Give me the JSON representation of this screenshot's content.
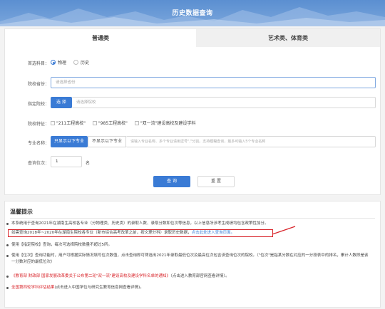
{
  "header": {
    "title": "历史数据查询"
  },
  "tabs": [
    {
      "label": "普通类"
    },
    {
      "label": "艺术类、体育类"
    }
  ],
  "form": {
    "subject": {
      "label": "首选科目：",
      "options": [
        "物理",
        "历史"
      ],
      "selected": "物理"
    },
    "province": {
      "label": "院校省份：",
      "placeholder": "请选择省份"
    },
    "school": {
      "label": "指定院校：",
      "button": "选 择",
      "placeholder": "请选择院校"
    },
    "features": {
      "label": "院校特征：",
      "options": [
        "\"211工程高校\"",
        "\"985工程高校\"",
        "\"双一流\"建设高校及建设学科"
      ]
    },
    "major": {
      "label": "专业名称：",
      "btn_only": "只显示以下专业",
      "btn_exclude": "不显示以下专业",
      "placeholder": "请输入专业名称、多个专业请用逗号\",\"分割。支持模糊查询，最多可输入5个专业名称"
    },
    "rank": {
      "label": "查询位次：",
      "value": "1",
      "unit": "名"
    },
    "submit": "查 询",
    "reset": "重 置"
  },
  "notice": {
    "title": "温馨提示",
    "items": [
      {
        "text": "本系统用于查询2021年在湖南生高校各专业（分物理类、历史类）的录取人数、录取分数和位次等信息，以上信息所涉考生成绩均包含政策性加分。"
      },
      {
        "text": "如需查询2018年~2020年在湖南生院校各专业（新市综合高考改革之前，按文理分科）录取历史数据，",
        "link": "点击此处进入查询页面。"
      },
      {
        "text": "使用【指定院校】查询，每次可选择院校数量不超过5所。"
      },
      {
        "text": "使用【位次】查询功能时，用户可根据实际情况填写位次数值，点击查询即可筛选出2021年录取最低位次及最高位次包含该查询位次的院校。（\"位次\"是指某分数在对应的一分段表中的排名，累计人数即是该一分数对应的最低位次）"
      },
      {
        "link": "《教育部 财政部 国家发展改革委关于公布第二轮\"双一流\"建设高校及建设学科名单的通知》",
        "text": "（点击进入教育部官网查看详情）。"
      },
      {
        "link": "全国第四轮学科评估结果",
        "text": "(点击进入中国学位与研究生教育信息网查看详情)。"
      }
    ]
  }
}
